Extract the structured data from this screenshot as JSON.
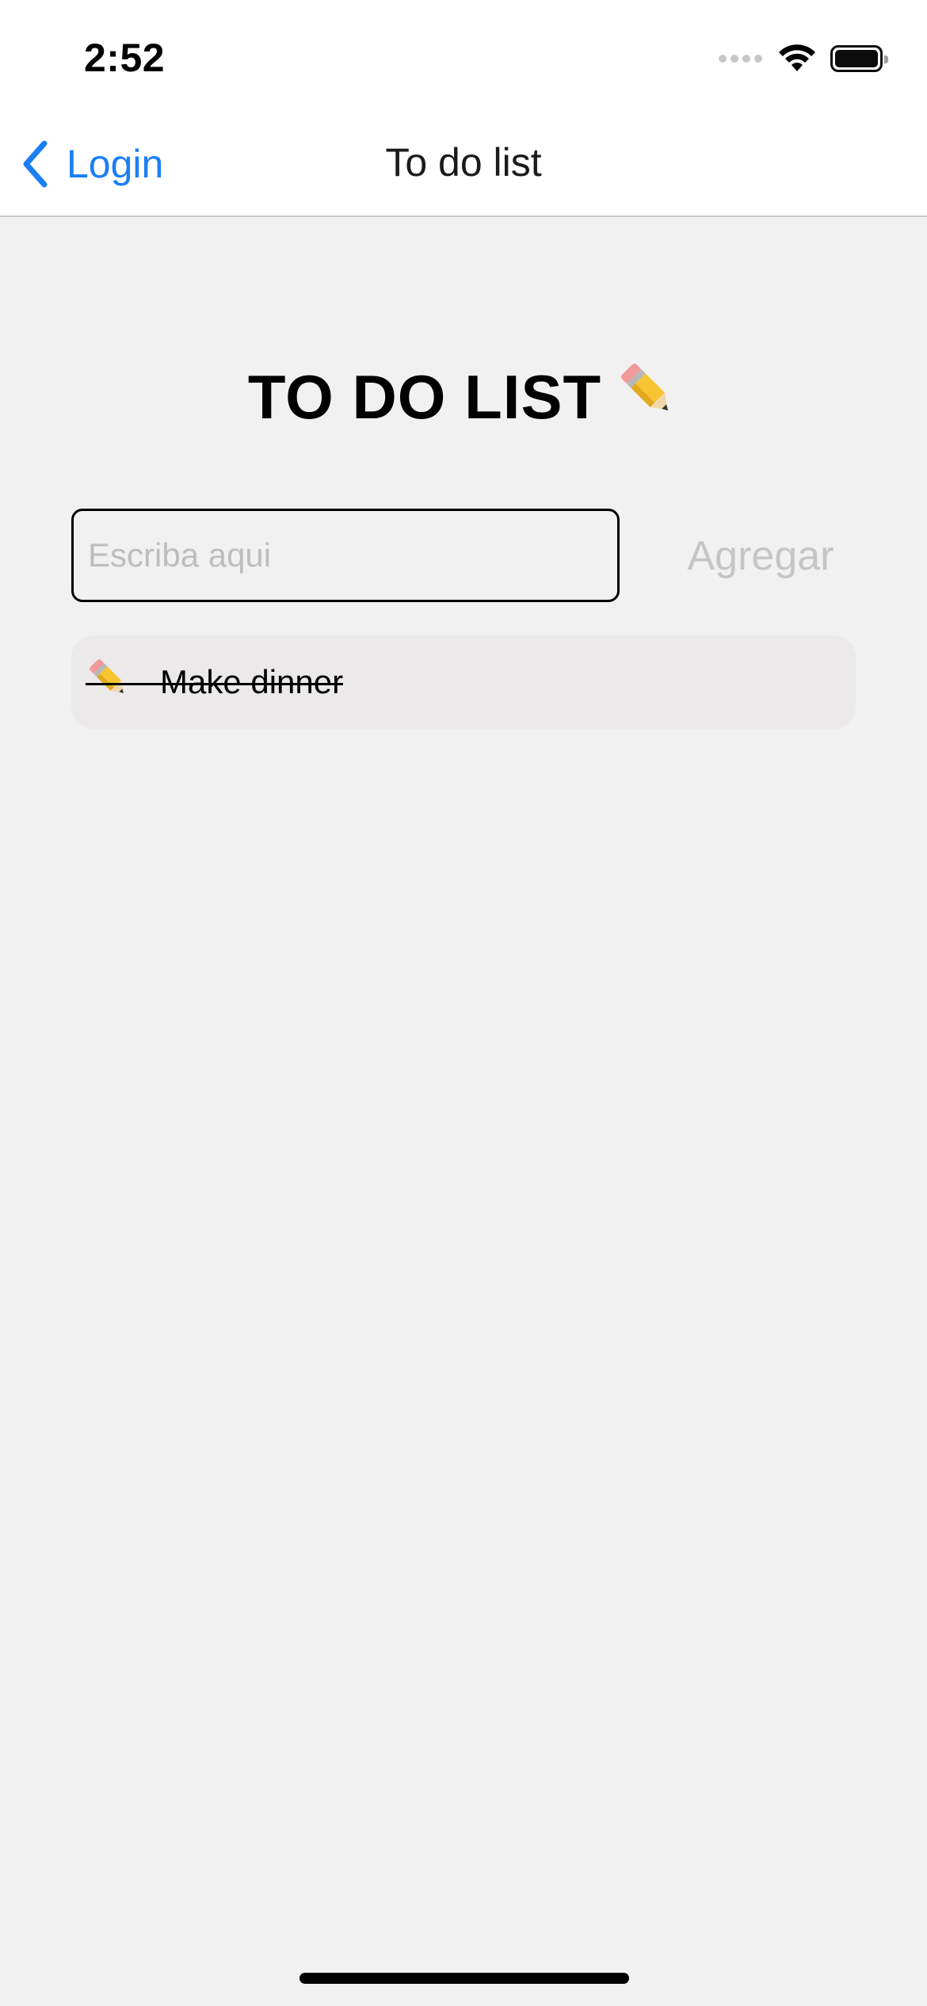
{
  "status_bar": {
    "time": "2:52",
    "icons": [
      "signal-dots-icon",
      "wifi-icon",
      "battery-icon"
    ]
  },
  "nav": {
    "back_label": "Login",
    "back_icon": "chevron-left-icon",
    "title": "To do list"
  },
  "main": {
    "heading": "TO DO LIST",
    "heading_icon": "pencil-icon",
    "input": {
      "value": "",
      "placeholder": "Escriba aqui"
    },
    "add_button_label": "Agregar",
    "todos": [
      {
        "icon": "pencil-icon",
        "text": "Make dinner",
        "completed": true
      }
    ]
  },
  "colors": {
    "accent": "#1a7ff5",
    "background": "#f1f1f1",
    "item_background": "#ebe9ea",
    "disabled_text": "#c5c5c5"
  }
}
